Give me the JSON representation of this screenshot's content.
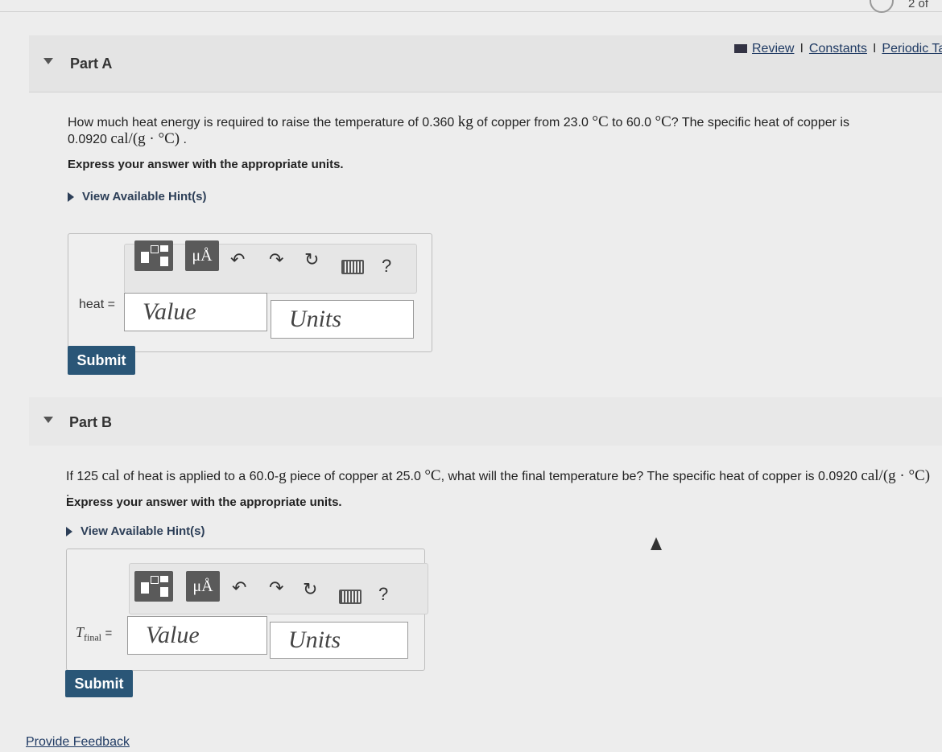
{
  "pager": {
    "text": "2 of"
  },
  "links": {
    "review": "Review",
    "constants": "Constants",
    "periodic": "Periodic Ta",
    "sep": "I"
  },
  "part_a": {
    "title": "Part A",
    "question_1": "How much heat energy is required to raise the temperature of 0.360",
    "unit_kg": "kg",
    "question_2": "of copper from 23.0",
    "unit_c1": "°C",
    "question_3": "to 60.0",
    "unit_c2": "°C",
    "question_4": "? The specific heat of copper is",
    "question_5": "0.0920",
    "unit_spec": "cal/(g · °C)",
    "question_end": ".",
    "instruction": "Express your answer with the appropriate units.",
    "hint": "View Available Hint(s)",
    "label": "heat =",
    "value_placeholder": "Value",
    "units_placeholder": "Units",
    "mu_label": "μÅ",
    "help": "?",
    "submit": "Submit"
  },
  "part_b": {
    "title": "Part B",
    "question_1": "If 125",
    "unit_cal": "cal",
    "question_2": "of heat is applied to a 60.0-",
    "unit_g": "g",
    "question_3": "piece of copper at 25.0",
    "unit_c": "°C",
    "question_4": ", what will the final temperature be? The specific heat of copper is 0.0920",
    "unit_spec": "cal/(g · °C)",
    "question_end": ".",
    "instruction": "Express your answer with the appropriate units.",
    "hint": "View Available Hint(s)",
    "label_main": "T",
    "label_sub": "final",
    "label_eq": "=",
    "value_placeholder": "Value",
    "units_placeholder": "Units",
    "mu_label": "μÅ",
    "help": "?",
    "submit": "Submit"
  },
  "footer": {
    "feedback": "Provide Feedback"
  }
}
